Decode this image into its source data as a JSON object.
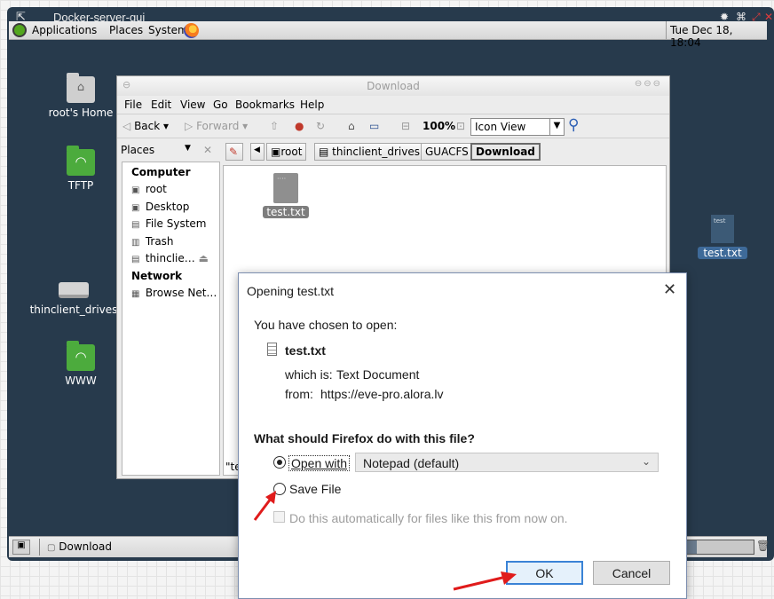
{
  "vnc_window": {
    "title": "Docker-server-gui"
  },
  "top_panel": {
    "menus": [
      "Applications",
      "Places",
      "System"
    ],
    "clock": "Tue Dec 18, 18:04"
  },
  "desktop_icons": [
    {
      "label": "root's Home",
      "icon": "home-folder-icon"
    },
    {
      "label": "TFTP",
      "icon": "wifi-folder-icon"
    },
    {
      "label": "thinclient_drives",
      "icon": "drive-icon"
    },
    {
      "label": "WWW",
      "icon": "wifi-folder-icon"
    },
    {
      "label": "test.txt",
      "icon": "text-file-icon"
    }
  ],
  "file_manager": {
    "title": "Download",
    "menu": [
      "File",
      "Edit",
      "View",
      "Go",
      "Bookmarks",
      "Help"
    ],
    "toolbar": {
      "back": "Back",
      "forward": "Forward",
      "zoom": "100%",
      "view_mode": "Icon View"
    },
    "sidebar": {
      "header": "Places",
      "sections": [
        {
          "title": "Computer",
          "items": [
            "root",
            "Desktop",
            "File System",
            "Trash",
            "thinclie…"
          ]
        },
        {
          "title": "Network",
          "items": [
            "Browse Net…"
          ]
        }
      ]
    },
    "path": [
      "root",
      "thinclient_drives",
      "GUACFS",
      "Download"
    ],
    "files": [
      {
        "name": "test.txt"
      }
    ],
    "status_fragment": "\"te"
  },
  "bottom_panel": {
    "task": "Download"
  },
  "dialog": {
    "title": "Opening test.txt",
    "intro": "You have chosen to open:",
    "filename": "test.txt",
    "which_is_label": "which is:",
    "which_is_value": "Text Document",
    "from_label": "from:",
    "from_value": "https://eve-pro.alora.lv",
    "question": "What should Firefox do with this file?",
    "open_with_label": "Open with",
    "open_with_app": "Notepad (default)",
    "save_file_label": "Save File",
    "selected_option": "open_with",
    "auto_label": "Do this automatically for files like this from now on.",
    "ok": "OK",
    "cancel": "Cancel"
  },
  "colors": {
    "desktop": "#273a4c",
    "annotation_arrow": "#e01b1b",
    "default_button_border": "#3a83d6",
    "selected_label": "#3e6a99"
  }
}
